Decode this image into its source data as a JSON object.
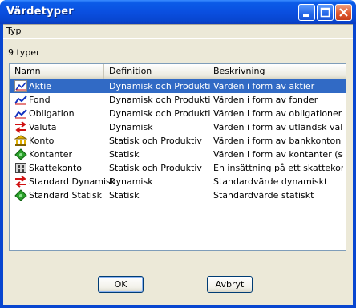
{
  "window": {
    "title": "Värdetyper"
  },
  "menubar": {
    "items": [
      "Typ"
    ]
  },
  "summary": {
    "count_text": "9 typer"
  },
  "list": {
    "columns": [
      "Namn",
      "Definition",
      "Beskrivning"
    ],
    "rows": [
      {
        "name": "Aktie",
        "definition": "Dynamisk och Produktiv",
        "description": "Värden i form av aktier",
        "icon": "stock-chart-icon",
        "selected": true
      },
      {
        "name": "Fond",
        "definition": "Dynamisk och Produktiv",
        "description": "Värden i form av fonder",
        "icon": "trend-line-icon",
        "selected": false
      },
      {
        "name": "Obligation",
        "definition": "Dynamisk och Produktiv",
        "description": "Värden i form av obligationer",
        "icon": "trend-line-icon",
        "selected": false
      },
      {
        "name": "Valuta",
        "definition": "Dynamisk",
        "description": "Värden i form av utländsk valuta",
        "icon": "exchange-arrows-icon",
        "selected": false
      },
      {
        "name": "Konto",
        "definition": "Statisk och Produktiv",
        "description": "Värden i form av bankkonton",
        "icon": "bank-icon",
        "selected": false
      },
      {
        "name": "Kontanter",
        "definition": "Statisk",
        "description": "Värden i form av kontanter (sed...",
        "icon": "banknote-icon",
        "selected": false
      },
      {
        "name": "Skattekonto",
        "definition": "Statisk och Produktiv",
        "description": "En insättning på ett skattekont...",
        "icon": "tax-account-icon",
        "selected": false
      },
      {
        "name": "Standard Dynamisk",
        "definition": "Dynamisk",
        "description": "Standardvärde dynamiskt",
        "icon": "exchange-arrows-icon",
        "selected": false
      },
      {
        "name": "Standard Statisk",
        "definition": "Statisk",
        "description": "Standardvärde statiskt",
        "icon": "banknote-icon",
        "selected": false
      }
    ]
  },
  "buttons": {
    "ok": "OK",
    "cancel": "Avbryt"
  },
  "colors": {
    "titlebar": "#0a4fe0",
    "selection": "#316ac5",
    "dialog": "#ece9d8",
    "close_button": "#e0582f"
  }
}
